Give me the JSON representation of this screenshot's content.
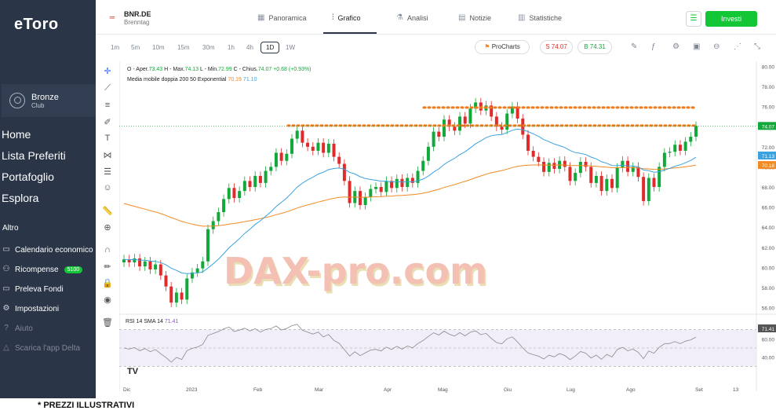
{
  "sidebar": {
    "logo": "eToro",
    "user_name": "Bronze",
    "user_sub": "Club",
    "nav": [
      {
        "label": "Home"
      },
      {
        "label": "Lista Preferiti"
      },
      {
        "label": "Portafoglio"
      },
      {
        "label": "Esplora"
      }
    ],
    "section_label": "Altro",
    "more": [
      {
        "label": "Calendario economico",
        "icon": "calendar-icon",
        "glyph": "▭"
      },
      {
        "label": "Ricompense",
        "icon": "gift-icon",
        "glyph": "⚇",
        "badge": "5100"
      },
      {
        "label": "Preleva Fondi",
        "icon": "withdraw-icon",
        "glyph": "▭"
      },
      {
        "label": "Impostazioni",
        "icon": "gear-icon",
        "glyph": "⚙"
      },
      {
        "label": "Aiuto",
        "icon": "help-icon",
        "glyph": "?"
      },
      {
        "label": "Scarica l'app Delta",
        "icon": "delta-icon",
        "glyph": "△"
      }
    ]
  },
  "header": {
    "ticker": "BNR.DE",
    "ticker_sub": "Brenntag",
    "tabs": [
      {
        "label": "Panoramica",
        "icon": "overview-icon"
      },
      {
        "label": "Grafico",
        "icon": "chart-icon"
      },
      {
        "label": "Analisi",
        "icon": "flask-icon"
      },
      {
        "label": "Notizie",
        "icon": "news-icon"
      },
      {
        "label": "Statistiche",
        "icon": "stats-icon"
      }
    ],
    "invest_label": "Investi"
  },
  "toolbar": {
    "timeframes": [
      "1m",
      "5m",
      "10m",
      "15m",
      "30m",
      "1h",
      "4h",
      "1D",
      "1W"
    ],
    "active_timeframe": "1D",
    "prochart_label": "ProCharts",
    "sell_label": "S 74.07",
    "buy_label": "B 74.31"
  },
  "legend": {
    "ohlc": "O - Aper.",
    "open": "73.43",
    "high_label": "H - Max.",
    "high": "74.13",
    "low_label": "L - Min.",
    "low": "72.99",
    "close_label": "C - Chius.",
    "close": "74.07",
    "change": "+0.68 (+0.93%)",
    "ma_label": "Media mobile doppia 200 50 Exponential",
    "ma200": "70.19",
    "ma50": "71.10"
  },
  "rsi_legend": {
    "label": "RSI 14 SMA 14",
    "value": "71.41"
  },
  "watermark": "DAX-pro.com",
  "footer": "* PREZZI ILLUSTRATIVI",
  "chart_data": {
    "type": "line",
    "title": "BNR.DE",
    "price_axis": {
      "ticks": [
        "80.00",
        "78.00",
        "76.00",
        "74.00",
        "72.00",
        "70.00",
        "68.00",
        "66.00",
        "64.00",
        "62.00",
        "60.00",
        "58.00",
        "56.00"
      ],
      "ylim": [
        55.5,
        80.5
      ]
    },
    "rsi_axis": {
      "ticks": [
        "60.00",
        "40.00"
      ],
      "ylim": [
        20,
        80
      ]
    },
    "x_labels": [
      "Dic",
      "2023",
      "Feb",
      "Mar",
      "Apr",
      "Mag",
      "Giu",
      "Lug",
      "Ago",
      "Set",
      "13"
    ],
    "last_price_label": "74.07",
    "ma50_label": "71.13",
    "ma200_label": "70.18",
    "rsi_value_label": "71.41",
    "resistance_levels": [
      74.1,
      75.9
    ],
    "colors": {
      "up": "#13a83a",
      "down": "#e02b2b",
      "ma50": "#3ba2e0",
      "ma200": "#f08a24",
      "rsi": "#8a8a8a",
      "level": "#f07a1a"
    },
    "series": [
      {
        "name": "Close",
        "values": [
          60.8,
          60.5,
          60.9,
          60.1,
          60.6,
          59.8,
          60.3,
          59.2,
          58.1,
          56.5,
          57.5,
          56.8,
          58.9,
          59.5,
          59.9,
          60.6,
          63.8,
          64.6,
          65.5,
          66.8,
          67.9,
          66.9,
          67.6,
          68.6,
          68.0,
          69.1,
          68.4,
          69.6,
          70.0,
          71.4,
          70.6,
          71.3,
          72.8,
          73.6,
          72.4,
          72.0,
          71.6,
          72.4,
          71.4,
          72.3,
          71.0,
          70.3,
          68.6,
          66.4,
          67.6,
          66.2,
          67.0,
          67.8,
          68.0,
          67.5,
          68.6,
          67.9,
          68.8,
          68.0,
          68.9,
          68.4,
          69.6,
          70.6,
          72.0,
          73.5,
          73.0,
          74.7,
          74.0,
          73.6,
          75.0,
          74.3,
          75.8,
          76.4,
          75.6,
          76.1,
          75.0,
          74.0,
          73.7,
          75.3,
          76.0,
          74.8,
          73.2,
          71.6,
          71.0,
          70.5,
          69.5,
          70.4,
          69.8,
          70.6,
          70.0,
          68.6,
          69.4,
          70.5,
          70.0,
          68.4,
          69.1,
          67.6,
          68.8,
          67.9,
          69.9,
          70.6,
          69.5,
          70.0,
          69.0,
          66.6,
          68.9,
          68.0,
          70.0,
          71.4,
          71.5,
          72.2,
          71.6,
          72.5,
          73.0,
          74.07
        ]
      },
      {
        "name": "Media mobile 50",
        "values": []
      },
      {
        "name": "Media mobile 200",
        "values": []
      },
      {
        "name": "RSI 14",
        "values": []
      }
    ]
  }
}
